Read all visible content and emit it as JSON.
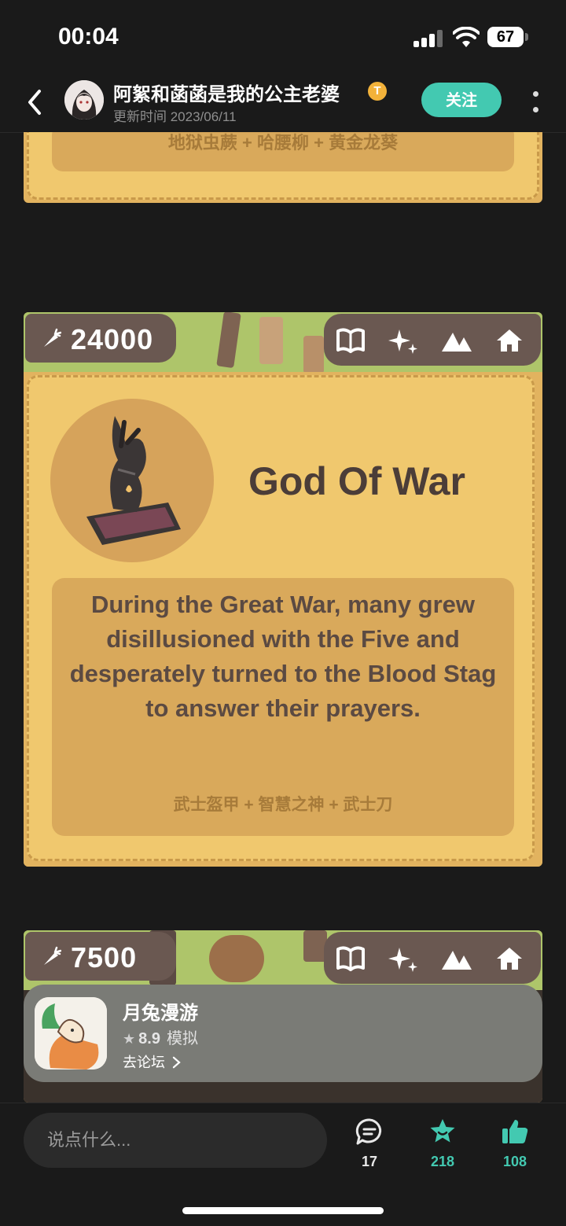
{
  "status_bar": {
    "time": "00:04",
    "battery": "67"
  },
  "header": {
    "author_name": "阿絮和菡菡是我的公主老婆",
    "badge": "T",
    "update_time": "更新时间 2023/06/11",
    "follow_label": "关注"
  },
  "cards": [
    {
      "recipe": "地狱虫蕨 + 哈腰柳 + 黄金龙葵"
    },
    {
      "cost": "24000",
      "title": "God Of War",
      "description": "During the Great War, many grew disillusioned with the Five and desperately turned to the Blood Stag to answer their prayers.",
      "recipe": "武士盔甲 + 智慧之神 + 武士刀"
    },
    {
      "cost": "7500"
    }
  ],
  "app_banner": {
    "name": "月兔漫游",
    "rating": "8.9",
    "category": "模拟",
    "forum_link": "去论坛"
  },
  "bottom_bar": {
    "comment_placeholder": "说点什么...",
    "comments_count": "17",
    "favorites_count": "218",
    "likes_count": "108"
  },
  "colors": {
    "accent": "#43c9b1",
    "card": "#e2b35f",
    "card_inner": "#f0c86e"
  },
  "icons": [
    "back-icon",
    "more-icon",
    "carrot-icon",
    "book-icon",
    "sparkle-icon",
    "mountain-icon",
    "home-icon",
    "star-icon",
    "comment-icon",
    "favorite-icon",
    "like-icon",
    "chevron-right-icon"
  ]
}
